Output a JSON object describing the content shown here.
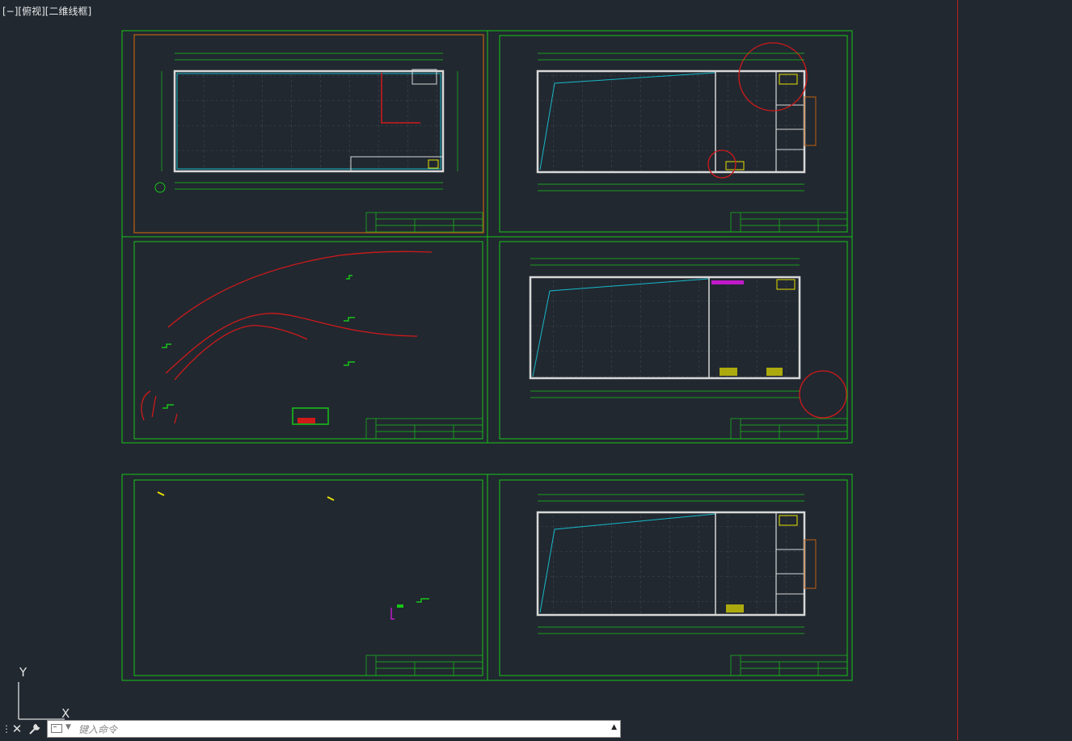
{
  "viewport": {
    "control": "[−]",
    "view": "[俯视]",
    "visual_style": "[二维线框]"
  },
  "ucs": {
    "y_label": "Y",
    "x_label": "X"
  },
  "command_line": {
    "placeholder": "键入命令"
  },
  "colors": {
    "background": "#212830",
    "sheet_border": "#19c419",
    "wall": "#d8d8d8",
    "cyan_line": "#17b8c8",
    "red_markup": "#d01a1a",
    "yellow_fill": "#e8e000",
    "magenta": "#c01ac8",
    "orange_border": "#c06010"
  },
  "icons": [
    "close-icon",
    "wrench-icon",
    "command-prompt-icon",
    "chevron-down-icon",
    "chevron-up-icon"
  ]
}
